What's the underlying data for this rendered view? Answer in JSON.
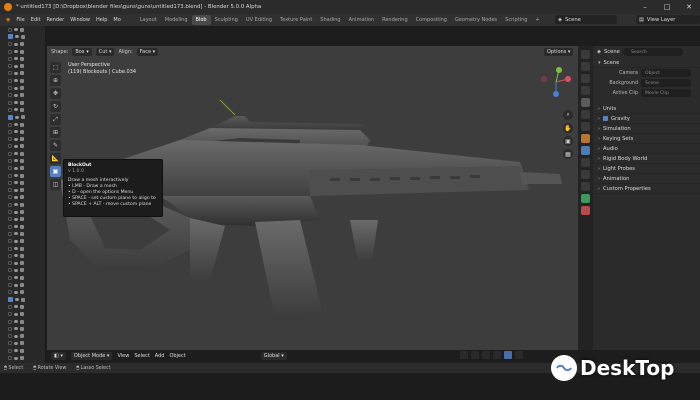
{
  "window": {
    "title": "* untitled173 [D:\\Dropbox\\blender files\\guns\\guns\\untitled173.blend] - Blender 5.0.0 Alpha"
  },
  "menu": [
    "File",
    "Edit",
    "Render",
    "Window",
    "Help",
    "Mo"
  ],
  "workspaces": [
    {
      "label": "Layout",
      "active": false
    },
    {
      "label": "Modeling",
      "active": false
    },
    {
      "label": "Blob",
      "active": true
    },
    {
      "label": "Sculpting",
      "active": false
    },
    {
      "label": "UV Editing",
      "active": false
    },
    {
      "label": "Texture Paint",
      "active": false
    },
    {
      "label": "Shading",
      "active": false
    },
    {
      "label": "Animation",
      "active": false
    },
    {
      "label": "Rendering",
      "active": false
    },
    {
      "label": "Compositing",
      "active": false
    },
    {
      "label": "Geometry Nodes",
      "active": false
    },
    {
      "label": "Scripting",
      "active": false
    },
    {
      "label": "+",
      "active": false
    }
  ],
  "scene_selector": "Scene",
  "view_layer_selector": "View Layer",
  "viewport": {
    "shape_label": "Shape:",
    "shape_value": "Box",
    "mode_value": "Cut",
    "align_label": "Align:",
    "align_value": "Face",
    "options": "Options",
    "perspective": "User Perspective",
    "object_line": "(119) Blockouts | Cube.034"
  },
  "tooltip": {
    "title": "BlockOut",
    "version": "v 1.0.0",
    "lines": [
      "Draw a mesh interactively",
      "• LMB - Draw a mesh",
      "• D - open the options Menu",
      "• SPACE - set custom plane to align to",
      "• SPACE + ALT - move custom plane"
    ]
  },
  "footer": {
    "mode": "Object Mode",
    "view": "View",
    "select": "Select",
    "add": "Add",
    "object": "Object",
    "transform": "Global"
  },
  "properties": {
    "header": "Scene",
    "search_placeholder": "Search",
    "scene_section": "Scene",
    "camera_label": "Camera",
    "camera_value": "Object",
    "background_label": "Background",
    "background_value": "Scene",
    "active_clip_label": "Active Clip",
    "active_clip_value": "Movie Clip",
    "sections": [
      "Units",
      "Gravity",
      "Simulation",
      "Keying Sets",
      "Audio",
      "Rigid Body World",
      "Light Probes",
      "Animation",
      "Custom Properties"
    ]
  },
  "statusbar": [
    "Select",
    "Rotate View",
    "Lasso Select"
  ],
  "watermark": "DeskTop",
  "colors": {
    "accent": "#5680c2",
    "brand": "#e87d0d"
  }
}
